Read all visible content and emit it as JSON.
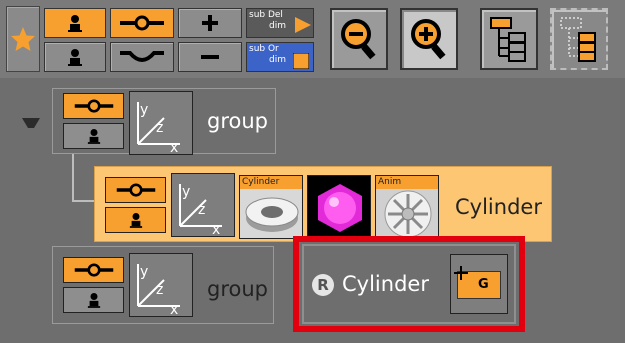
{
  "toolbar": {
    "favorite_icon": "star-icon",
    "sub_buttons": [
      {
        "line1": "sub Del",
        "line2": "dim"
      },
      {
        "line1": "sub Or",
        "line2": "dim"
      }
    ],
    "zoom_out_icon": "zoom-out-icon",
    "zoom_in_icon": "zoom-in-icon",
    "tree_view_icon": "tree-view-icon",
    "tree_view_alt_icon": "tree-view-dotted-icon"
  },
  "tree": {
    "root": {
      "label": "group",
      "expand_icon": "triangle-down-icon"
    },
    "child": {
      "label": "Cylinder",
      "thumbs": [
        {
          "caption": "Cylinder",
          "icon": "cylinder-geometry-icon"
        },
        {
          "caption": "",
          "icon": "material-sphere-icon"
        },
        {
          "caption": "Anim",
          "icon": "texture-wheel-icon"
        }
      ]
    },
    "sibling": {
      "label": "group"
    },
    "reference": {
      "badge": "R",
      "label": "Cylinder",
      "tag_text": "G"
    }
  },
  "colors": {
    "accent": "#f7a030",
    "selected_node": "#fcc673",
    "highlight": "#e3000e",
    "panel": "#6e6e6e"
  }
}
